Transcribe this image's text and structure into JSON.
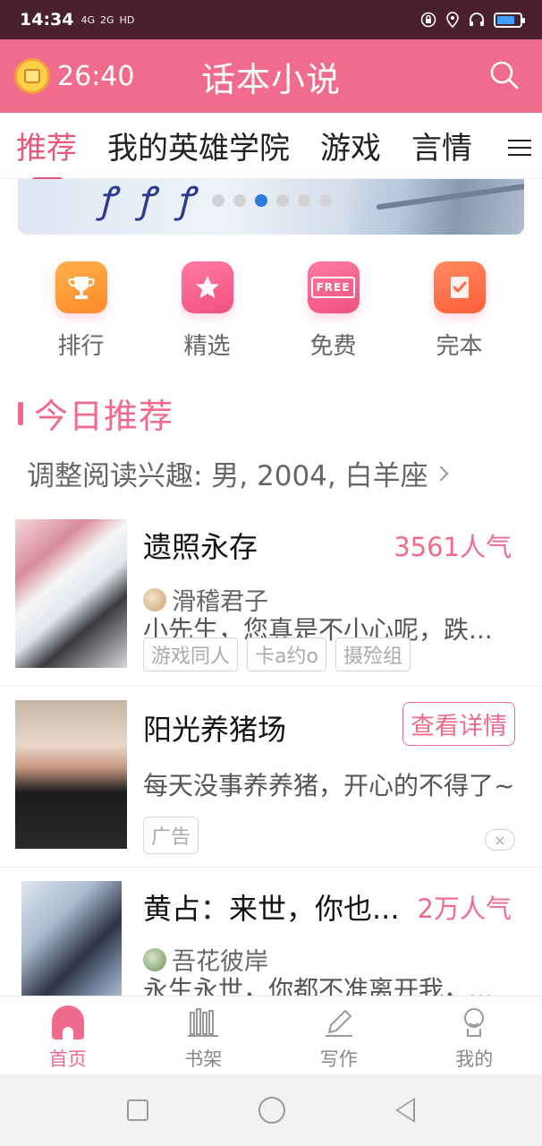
{
  "status_bar": {
    "time": "14:34",
    "signals": [
      "4G",
      "2G",
      "HD"
    ],
    "battery_level": 0.8
  },
  "app_bar": {
    "timer": "26:40",
    "title": "话本小说",
    "search_icon": "search-icon"
  },
  "tabs": [
    "推荐",
    "我的英雄学院",
    "游戏",
    "言情"
  ],
  "banner": {
    "dots_total": 6,
    "active_dot": 3
  },
  "quick_entries": [
    {
      "label": "排行",
      "icon": "trophy-icon"
    },
    {
      "label": "精选",
      "icon": "star-icon"
    },
    {
      "label": "免费",
      "icon": "free-icon",
      "badge": "FREE"
    },
    {
      "label": "完本",
      "icon": "check-book-icon"
    }
  ],
  "section": {
    "title": "今日推荐",
    "interest": "调整阅读兴趣: 男, 2004, 白羊座"
  },
  "books": [
    {
      "name": "遗照永存",
      "popularity": "3561人气",
      "author": "滑稽君子",
      "desc": "小先生，您真是不小心呢，跌...",
      "tags": [
        "游戏同人",
        "卡a约o",
        "摄殓组"
      ]
    },
    {
      "name": "阳光养猪场",
      "action": "查看详情",
      "desc": "每天没事养养猪，开心的不得了~",
      "ad_label": "广告",
      "close": "×"
    },
    {
      "name": "黄占：来世，你也...",
      "popularity": "2万人气",
      "author": "吾花彼岸",
      "desc": "永生永世，你都不准离开我，..."
    }
  ],
  "bottom_nav": [
    {
      "label": "首页",
      "active": true
    },
    {
      "label": "书架",
      "active": false
    },
    {
      "label": "写作",
      "active": false
    },
    {
      "label": "我的",
      "active": false
    }
  ],
  "colors": {
    "accent": "#ef6a8c",
    "header": "#f16b8c",
    "status_bar": "#4a1f2e"
  }
}
